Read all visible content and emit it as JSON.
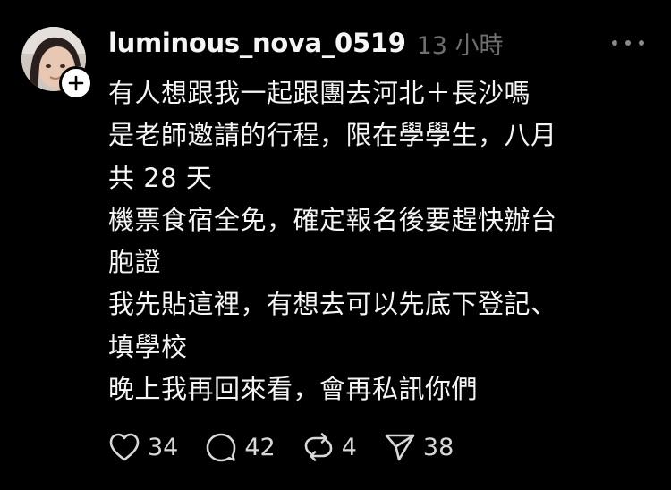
{
  "post": {
    "username": "luminous_nova_0519",
    "timestamp": "13 小時",
    "lines": [
      "有人想跟我一起跟團去河北＋長沙嗎",
      "是老師邀請的行程，限在學學生，八月",
      "共 28 天",
      "機票食宿全免，確定報名後要趕快辦台",
      "胞證",
      "我先貼這裡，有想去可以先底下登記、",
      "填學校",
      "晚上我再回來看，會再私訊你們"
    ]
  },
  "actions": {
    "likes": "34",
    "comments": "42",
    "reposts": "4",
    "shares": "38"
  },
  "icons": {
    "more": "more-horizontal-icon",
    "follow": "plus-icon",
    "like": "heart-icon",
    "comment": "speech-bubble-icon",
    "repost": "repost-arrows-icon",
    "share": "paper-plane-icon"
  },
  "colors": {
    "background": "#000000",
    "text": "#f5f5f5",
    "muted": "#6f6f6f"
  }
}
